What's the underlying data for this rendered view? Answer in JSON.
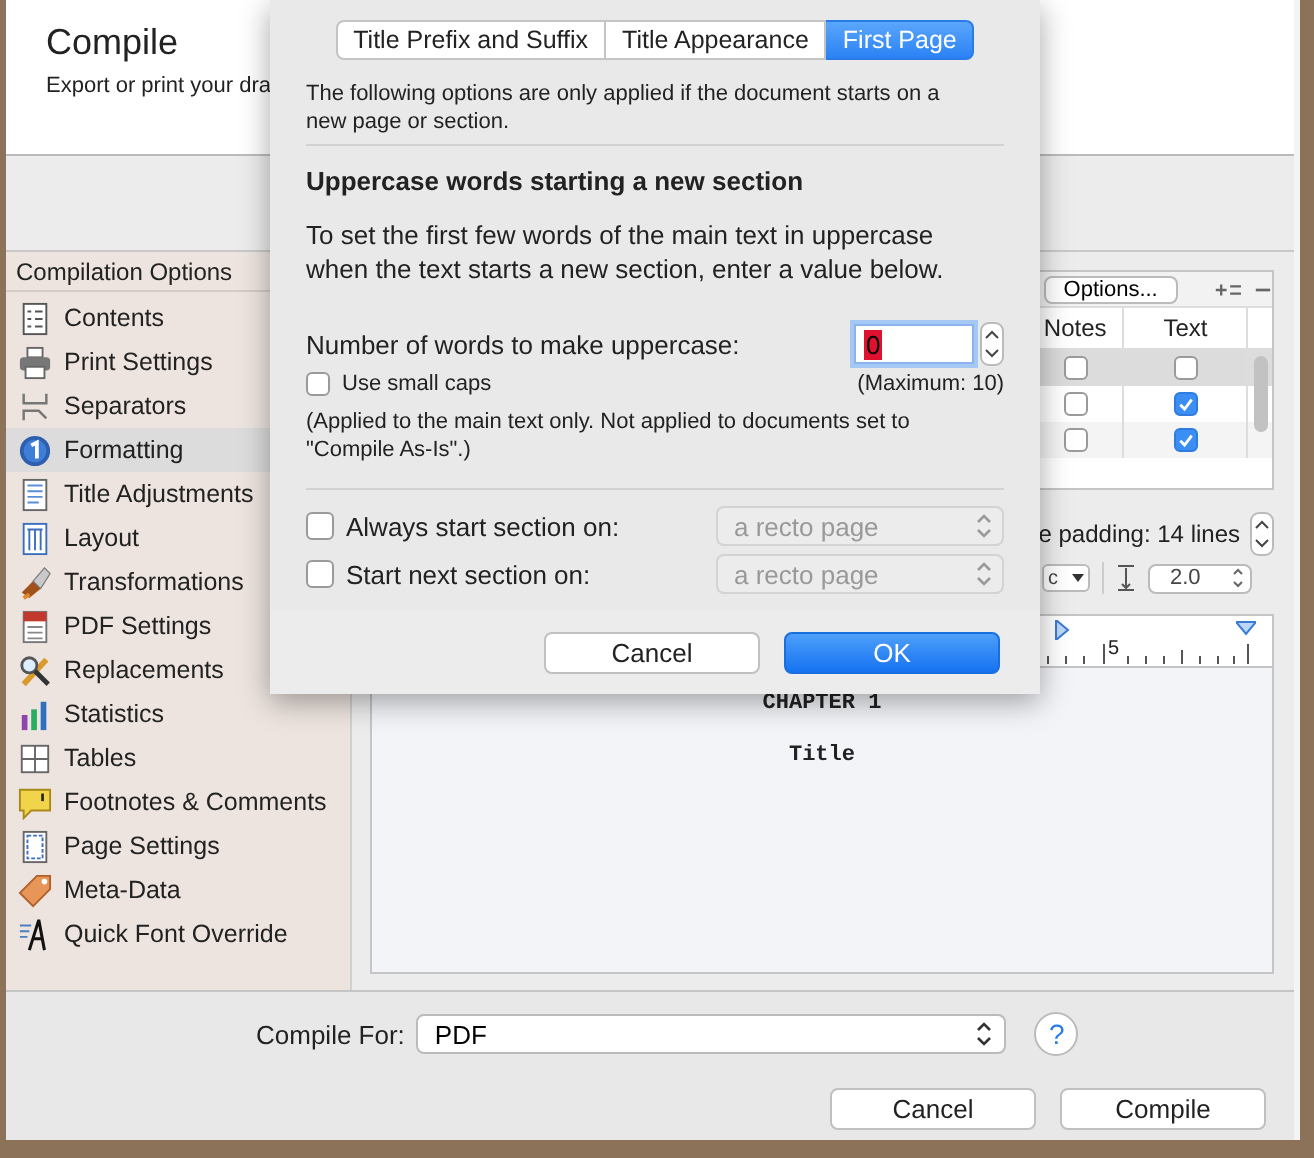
{
  "window": {
    "title": "Compile",
    "subtitle": "Export or print your dra"
  },
  "sidebar": {
    "header": "Compilation Options",
    "items": [
      {
        "label": "Contents",
        "selected": false
      },
      {
        "label": "Print Settings",
        "selected": false
      },
      {
        "label": "Separators",
        "selected": false
      },
      {
        "label": "Formatting",
        "selected": true
      },
      {
        "label": "Title Adjustments",
        "selected": false
      },
      {
        "label": "Layout",
        "selected": false
      },
      {
        "label": "Transformations",
        "selected": false
      },
      {
        "label": "PDF Settings",
        "selected": false
      },
      {
        "label": "Replacements",
        "selected": false
      },
      {
        "label": "Statistics",
        "selected": false
      },
      {
        "label": "Tables",
        "selected": false
      },
      {
        "label": "Footnotes & Comments",
        "selected": false
      },
      {
        "label": "Page Settings",
        "selected": false
      },
      {
        "label": "Meta-Data",
        "selected": false
      },
      {
        "label": "Quick Font Override",
        "selected": false
      }
    ]
  },
  "contents_table": {
    "options_button": "Options...",
    "columns": [
      "Notes",
      "Text"
    ],
    "rows": [
      {
        "selected": true,
        "notes": false,
        "text": false
      },
      {
        "selected": false,
        "notes": false,
        "text": true
      },
      {
        "selected": false,
        "notes": false,
        "text": true
      }
    ]
  },
  "page_padding": "e padding: 14 lines",
  "format_popup": "c",
  "line_spacing": "2.0",
  "ruler_labels": [
    "5"
  ],
  "preview": {
    "lines": [
      "CHAPTER 1",
      "Title"
    ]
  },
  "compile_for": {
    "label": "Compile For:",
    "value": "PDF",
    "help": "?"
  },
  "buttons": [
    {
      "label": "Cancel",
      "primary": false
    },
    {
      "label": "Compile",
      "primary": false
    }
  ],
  "sheet": {
    "tabs": [
      {
        "label": "Title Prefix and Suffix",
        "selected": false
      },
      {
        "label": "Title Appearance",
        "selected": false
      },
      {
        "label": "First Page",
        "selected": true
      }
    ],
    "intro": "The following options are only applied if the document starts on a new page or section.",
    "heading": "Uppercase words starting a new section",
    "instructions": "To set the first few words of the main text in uppercase when the text starts a new section, enter a value below.",
    "uppercase": {
      "label": "Number of words to make uppercase:",
      "value": "0",
      "maximum": "(Maximum: 10)"
    },
    "small_caps": {
      "label": "Use small caps",
      "checked": false
    },
    "note": "(Applied to the main text only. Not applied to documents set to \"Compile As-Is\".)",
    "section_options": [
      {
        "label": "Always start section on:",
        "checked": false,
        "value": "a recto page",
        "disabled": true
      },
      {
        "label": "Start next section on:",
        "checked": false,
        "value": "a recto page",
        "disabled": true
      }
    ],
    "buttons": [
      {
        "label": "Cancel",
        "primary": false
      },
      {
        "label": "OK",
        "primary": true
      }
    ]
  }
}
